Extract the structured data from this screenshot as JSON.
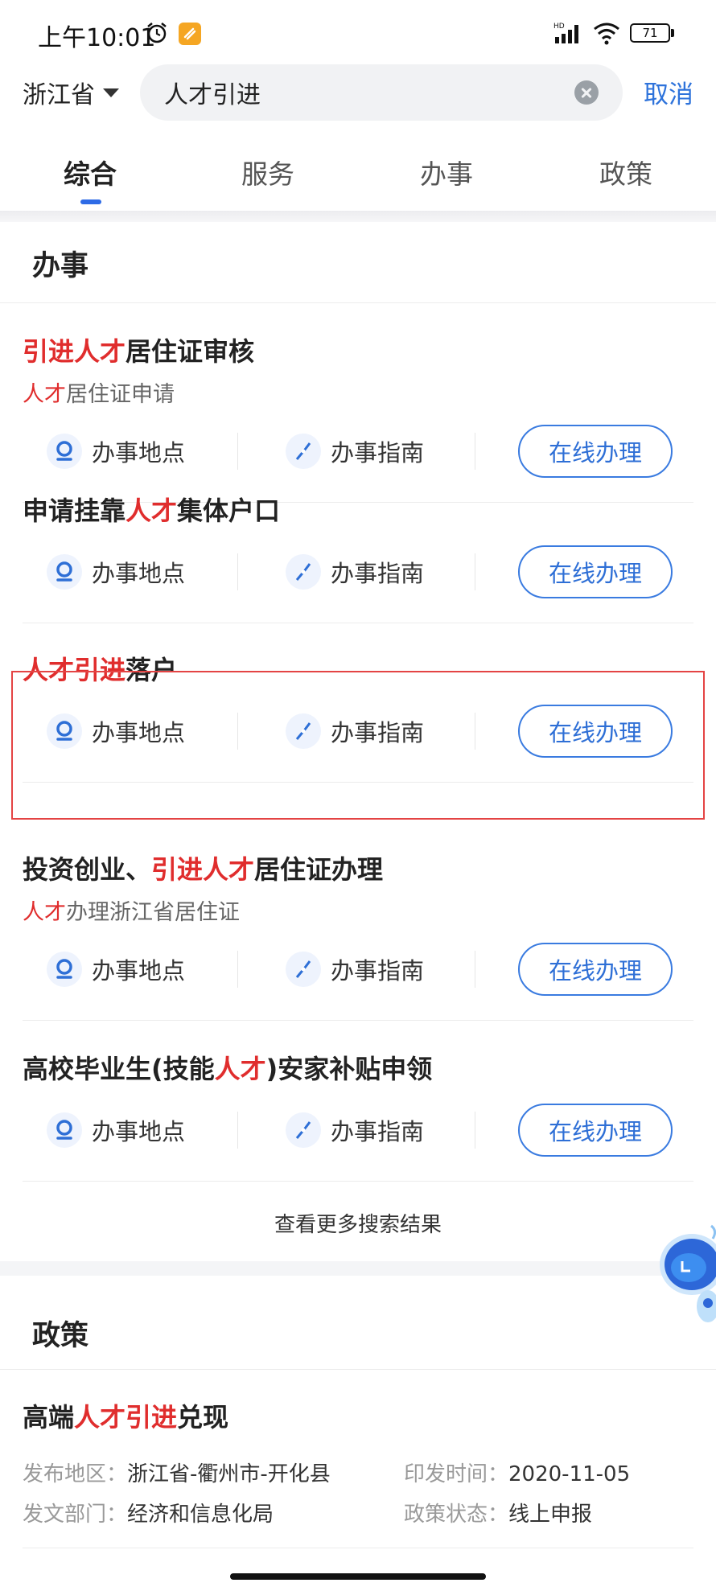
{
  "status_bar": {
    "time": "上午10:01",
    "battery": "71",
    "network_label": "HD"
  },
  "search": {
    "region": "浙江省",
    "query": "人才引进",
    "cancel_label": "取消"
  },
  "tabs": [
    {
      "label": "综合",
      "active": true
    },
    {
      "label": "服务",
      "active": false
    },
    {
      "label": "办事",
      "active": false
    },
    {
      "label": "政策",
      "active": false
    }
  ],
  "affairs": {
    "section_title": "办事",
    "action_location_label": "办事地点",
    "action_guide_label": "办事指南",
    "online_button_label": "在线办理",
    "items": [
      {
        "title": [
          {
            "t": "引进人才",
            "hl": true
          },
          {
            "t": "居住证审核",
            "hl": false
          }
        ],
        "subtitle": [
          {
            "t": "人才",
            "hl": true
          },
          {
            "t": "居住证申请",
            "hl": false
          }
        ]
      },
      {
        "title": [
          {
            "t": "申请挂靠",
            "hl": false
          },
          {
            "t": "人才",
            "hl": true
          },
          {
            "t": "集体户口",
            "hl": false
          }
        ]
      },
      {
        "title": [
          {
            "t": "人才引进",
            "hl": true
          },
          {
            "t": "落户",
            "hl": false
          }
        ],
        "highlighted": true
      },
      {
        "title": [
          {
            "t": "投资创业、",
            "hl": false
          },
          {
            "t": "引进人才",
            "hl": true
          },
          {
            "t": "居住证办理",
            "hl": false
          }
        ],
        "subtitle": [
          {
            "t": "人才",
            "hl": true
          },
          {
            "t": "办理浙江省居住证",
            "hl": false
          }
        ]
      },
      {
        "title": [
          {
            "t": "高校毕业生(技能",
            "hl": false
          },
          {
            "t": "人才",
            "hl": true
          },
          {
            "t": ")安家补贴申领",
            "hl": false
          }
        ]
      }
    ],
    "more_label": "查看更多搜索结果"
  },
  "policy": {
    "section_title": "政策",
    "item": {
      "title": [
        {
          "t": "高端",
          "hl": false
        },
        {
          "t": "人才引进",
          "hl": true
        },
        {
          "t": "兑现",
          "hl": false
        }
      ],
      "region_key": "发布地区：",
      "region_val": "浙江省-衢州市-开化县",
      "date_key": "印发时间：",
      "date_val": "2020-11-05",
      "dept_key": "发文部门：",
      "dept_val": "经济和信息化局",
      "status_key": "政策状态：",
      "status_val": "线上申报"
    }
  },
  "colors": {
    "accent": "#2e6fd6",
    "highlight": "#e02d2d",
    "frame": "#e44444"
  }
}
